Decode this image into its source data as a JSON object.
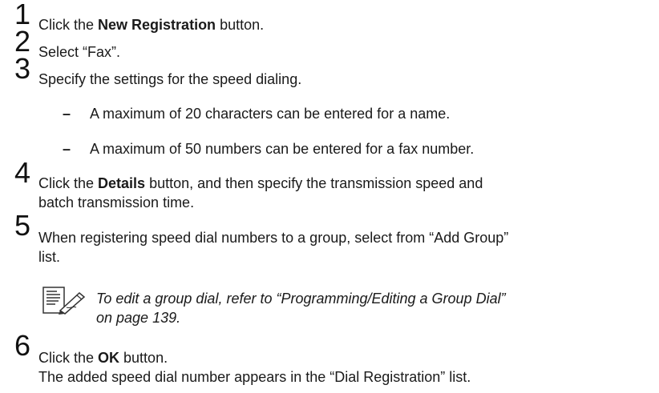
{
  "steps": [
    {
      "number": "1",
      "text_before": "Click the ",
      "bold": "New Registration",
      "text_after": " button."
    },
    {
      "number": "2",
      "text": "Select “Fax”."
    },
    {
      "number": "3",
      "text": "Specify the settings for the speed dialing."
    },
    {
      "number": "4",
      "line1_before": "Click the ",
      "bold": "Details",
      "line1_after": " button, and then specify the transmission speed and",
      "line2": "batch transmission time."
    },
    {
      "number": "5",
      "line1": "When registering speed dial numbers to a group, select from “Add Group”",
      "line2": "list."
    },
    {
      "number": "6",
      "line1_before": "Click the ",
      "bold": "OK",
      "line1_after": " button.",
      "line2": "The added speed dial number appears in the “Dial Registration” list."
    }
  ],
  "bullets": [
    {
      "symbol": "–",
      "text": "A maximum of 20 characters can be entered for a name."
    },
    {
      "symbol": "–",
      "text": "A maximum of 50 numbers can be entered for a fax number."
    }
  ],
  "note": {
    "icon": "note-pencil-icon",
    "line1": "To edit a group dial, refer to “Programming/Editing a Group Dial”",
    "line2": "on page 139."
  }
}
